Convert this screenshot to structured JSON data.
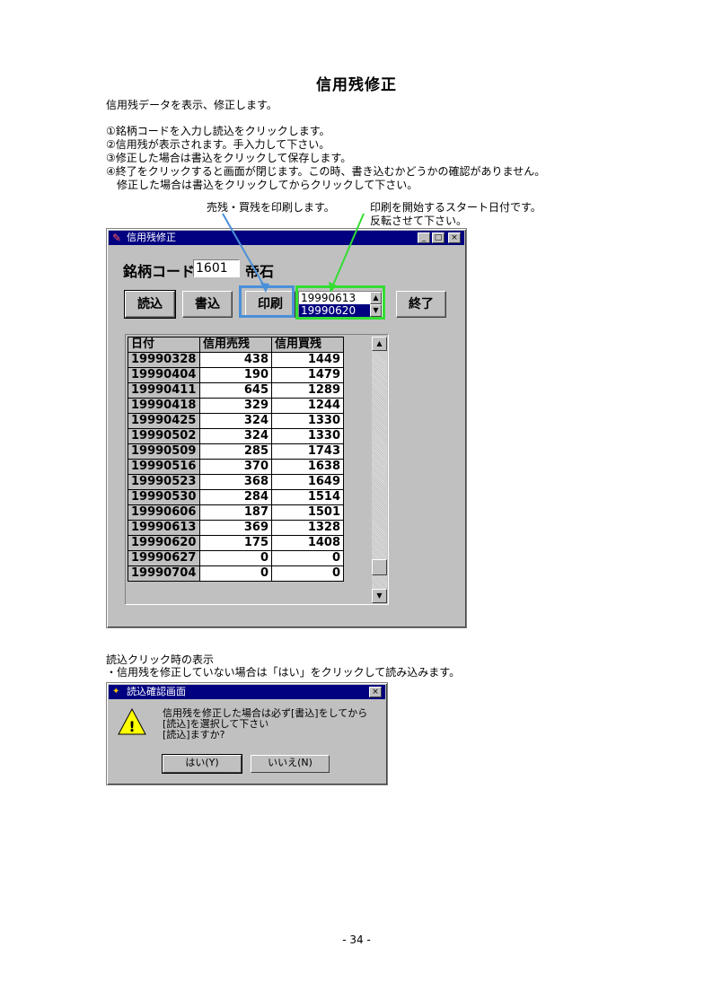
{
  "doc": {
    "title": "信用残修正",
    "intro": "信用残データを表示、修正します。",
    "steps": [
      "①銘柄コードを入力し読込をクリックします。",
      "②信用残が表示されます。手入力して下さい。",
      "③修正した場合は書込をクリックして保存します。",
      "④終了をクリックすると画面が閉じます。この時、書き込むかどうかの確認がありません。",
      "　修正した場合は書込をクリックしてからクリックして下さい。"
    ],
    "callout_print": "売残・買残を印刷します。",
    "callout_date_1": "印刷を開始するスタート日付です。",
    "callout_date_2": "反転させて下さい。",
    "section2_title": "読込クリック時の表示",
    "section2_text": "・信用残を修正していない場合は「はい」をクリックして読み込みます。",
    "page_number": "- 34 -"
  },
  "colors": {
    "callout_blue": "#4a90d9",
    "callout_green": "#33dd33",
    "titlebar": "#000080"
  },
  "window": {
    "title": "信用残修正",
    "code_label": "銘柄コード",
    "code_value": "1601",
    "stock_name": "帝石",
    "buttons": {
      "load": "読込",
      "write": "書込",
      "print": "印刷",
      "exit": "終了"
    },
    "date_list": [
      "19990613",
      "19990620"
    ],
    "date_selected": "19990620",
    "table": {
      "headers": [
        "日付",
        "信用売残",
        "信用買残"
      ],
      "rows": [
        [
          "19990328",
          "438",
          "1449"
        ],
        [
          "19990404",
          "190",
          "1479"
        ],
        [
          "19990411",
          "645",
          "1289"
        ],
        [
          "19990418",
          "329",
          "1244"
        ],
        [
          "19990425",
          "324",
          "1330"
        ],
        [
          "19990502",
          "324",
          "1330"
        ],
        [
          "19990509",
          "285",
          "1743"
        ],
        [
          "19990516",
          "370",
          "1638"
        ],
        [
          "19990523",
          "368",
          "1649"
        ],
        [
          "19990530",
          "284",
          "1514"
        ],
        [
          "19990606",
          "187",
          "1501"
        ],
        [
          "19990613",
          "369",
          "1328"
        ],
        [
          "19990620",
          "175",
          "1408"
        ],
        [
          "19990627",
          "0",
          "0"
        ],
        [
          "19990704",
          "0",
          "0"
        ]
      ]
    }
  },
  "dialog": {
    "title": "読込確認画面",
    "message_1": "信用残を修正した場合は必ず[書込]をしてから",
    "message_2": "[読込]を選択して下さい",
    "message_3": "[読込]ますか?",
    "yes": "はい(Y)",
    "no": "いいえ(N)"
  }
}
